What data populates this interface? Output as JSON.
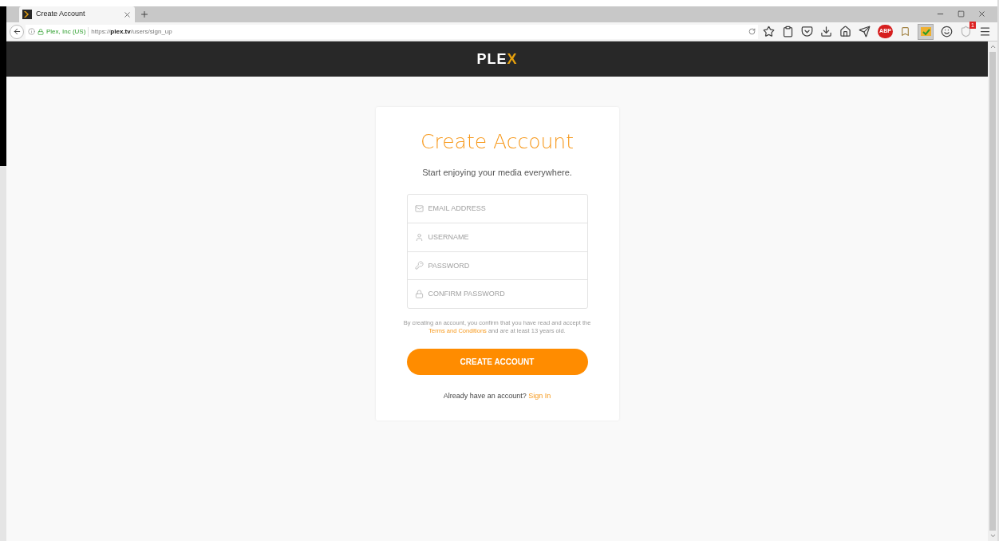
{
  "browser": {
    "tab": {
      "title": "Create Account",
      "selected": true
    },
    "address": {
      "identity": "Plex, Inc (US)",
      "url_prefix": "https://",
      "url_host": "plex.tv",
      "url_path": "/users/sign_up"
    },
    "toolbar_badges": {
      "adblock": "ABP",
      "shield_count": "1"
    }
  },
  "header": {
    "logo_main": "PLE",
    "logo_accent": "X"
  },
  "form": {
    "title": "Create Account",
    "subtitle": "Start enjoying your media everywhere.",
    "fields": [
      {
        "kind": "email",
        "placeholder": "EMAIL ADDRESS"
      },
      {
        "kind": "user",
        "placeholder": "USERNAME"
      },
      {
        "kind": "key",
        "placeholder": "PASSWORD"
      },
      {
        "kind": "lock",
        "placeholder": "CONFIRM PASSWORD"
      }
    ],
    "terms": {
      "before": "By creating an account, you confirm that you have read and accept the",
      "link": "Terms and Conditions",
      "after": "and are at least 13 years old."
    },
    "submit": "CREATE ACCOUNT",
    "signin": {
      "prompt": "Already have an account?",
      "link": "Sign In"
    }
  }
}
